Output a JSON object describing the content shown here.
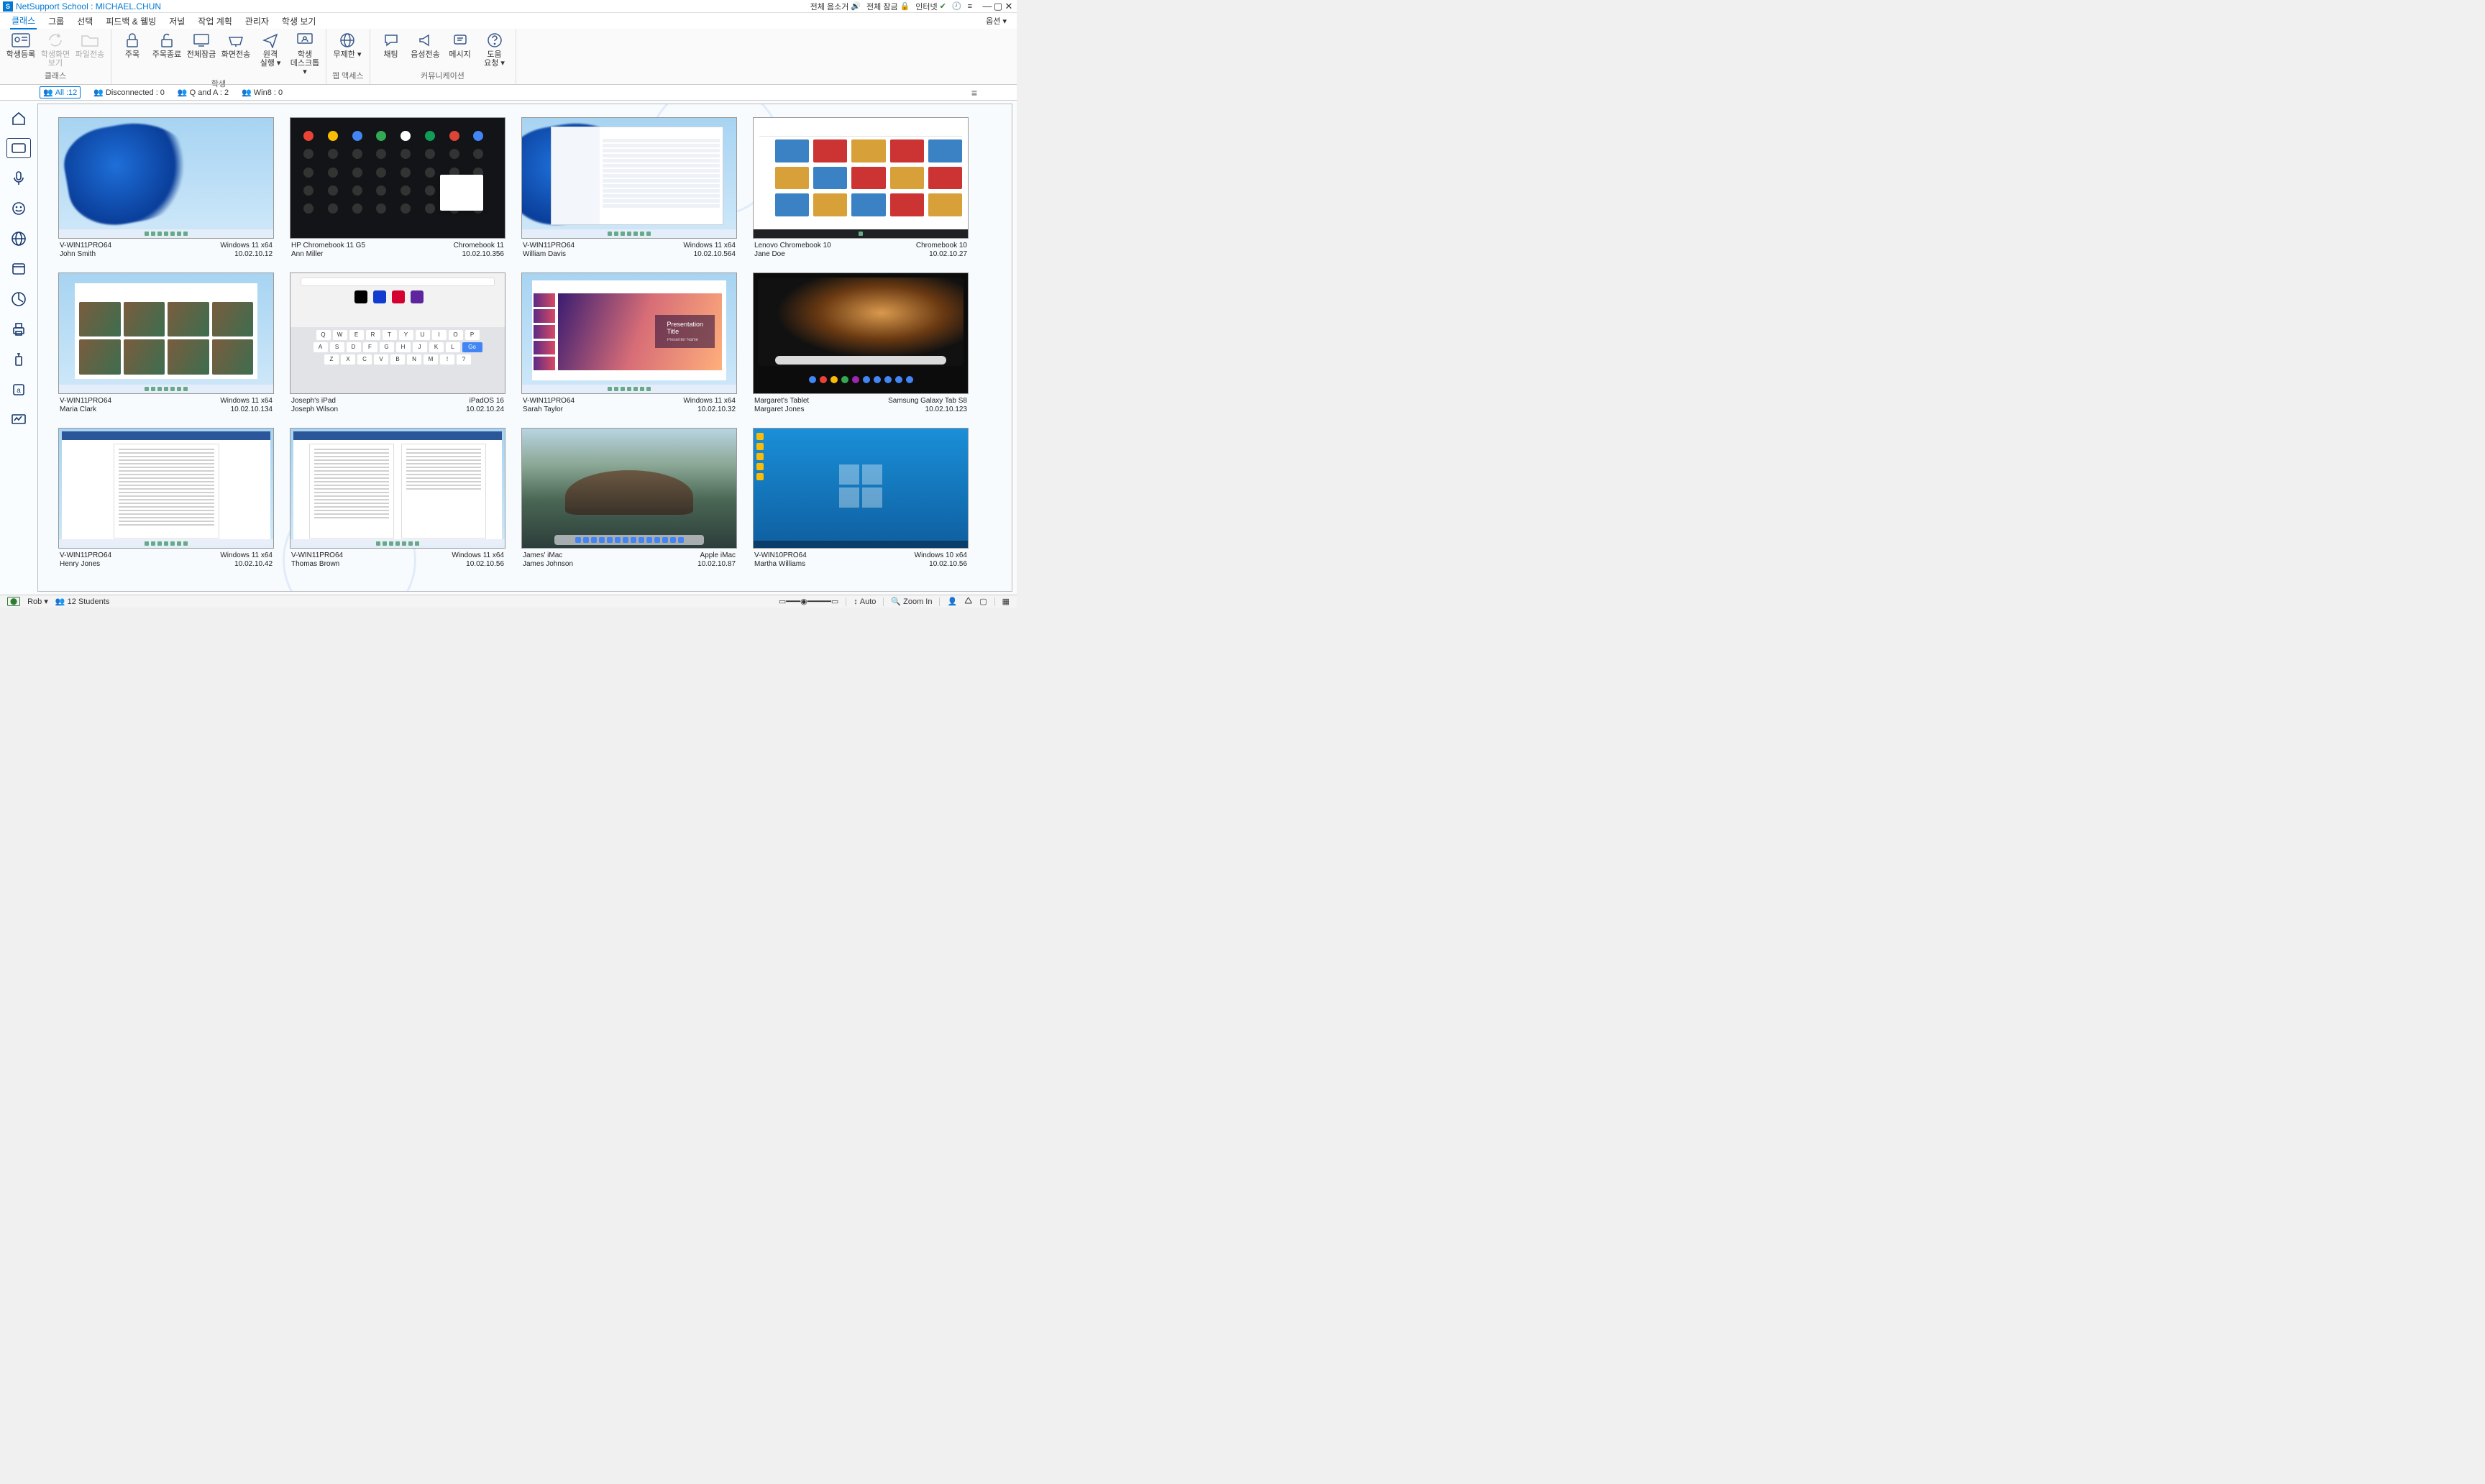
{
  "title": {
    "app": "NetSupport School",
    "sep": " : ",
    "machine": "MICHAEL.CHUN"
  },
  "titlebar_right": {
    "mute_all": "전체 음소거",
    "lock_all": "전체 잠금",
    "internet": "인터넷"
  },
  "menu": {
    "class": "클래스",
    "group": "그룹",
    "select": "선택",
    "feedback": "피드백 & 웰빙",
    "journal": "저널",
    "planner": "작업 계획",
    "admin": "관리자",
    "view": "학생 보기",
    "options": "옵션"
  },
  "ribbon": {
    "register": "학생등록",
    "screenshot": "학생화면\n보기",
    "file_transfer": "파일전송",
    "attention": "주목",
    "end_attention": "주목종료",
    "lock_all": "전체잠금",
    "show": "화면전송",
    "remote_run": "원격\n실행",
    "student_desktop": "학생\n데스크톱",
    "unlimited": "무제한",
    "chat": "채팅",
    "audio": "음성전송",
    "message": "메시지",
    "help": "도움\n요청",
    "group_class": "클래스",
    "group_student": "학생",
    "group_web": "웹 액세스",
    "group_comm": "커뮤니케이션"
  },
  "tabs": {
    "all": "All :12",
    "disconnected": "Disconnected : 0",
    "qa": "Q and A : 2",
    "win8": "Win8 : 0"
  },
  "thumbs": [
    {
      "host": "V-WIN11PRO64",
      "os": "Windows 11 x64",
      "user": "John Smith",
      "ip": "10.02.10.12",
      "type": "win11"
    },
    {
      "host": "HP Chromebook 11 G5",
      "os": "Chromebook 11",
      "user": "Ann Miller",
      "ip": "10.02.10.356",
      "type": "chrome-dark"
    },
    {
      "host": "V-WIN11PRO64",
      "os": "Windows 11 x64",
      "user": "William Davis",
      "ip": "10.02.10.564",
      "type": "win11-explorer"
    },
    {
      "host": "Lenovo Chromebook 10",
      "os": "Chromebook 10",
      "user": "Jane Doe",
      "ip": "10.02.10.27",
      "type": "chromebk-web"
    },
    {
      "host": "V-WIN11PRO64",
      "os": "Windows 11 x64",
      "user": "Maria Clark",
      "ip": "10.02.10.134",
      "type": "edge-news"
    },
    {
      "host": "Joseph's iPad",
      "os": "iPadOS 16",
      "user": "Joseph Wilson",
      "ip": "10.02.10.24",
      "type": "ipad",
      "keys": [
        [
          "Q",
          "W",
          "E",
          "R",
          "T",
          "Y",
          "U",
          "I",
          "O",
          "P"
        ],
        [
          "A",
          "S",
          "D",
          "F",
          "G",
          "H",
          "J",
          "K",
          "L",
          "Go"
        ],
        [
          "Z",
          "X",
          "C",
          "V",
          "B",
          "N",
          "M",
          "!",
          "?"
        ]
      ]
    },
    {
      "host": "V-WIN11PRO64",
      "os": "Windows 11 x64",
      "user": "Sarah Taylor",
      "ip": "10.02.10.32",
      "type": "ppt",
      "title": "Presentation\nTitle",
      "sub": "Presenter Name"
    },
    {
      "host": "Margaret's Tablet",
      "os": "Samsung Galaxy Tab S8",
      "user": "Margaret Jones",
      "ip": "10.02.10.123",
      "type": "android"
    },
    {
      "host": "V-WIN11PRO64",
      "os": "Windows 11 x64",
      "user": "Henry Jones",
      "ip": "10.02.10.42",
      "type": "word"
    },
    {
      "host": "V-WIN11PRO64",
      "os": "Windows 11 x64",
      "user": "Thomas Brown",
      "ip": "10.02.10.56",
      "type": "word2"
    },
    {
      "host": "James' iMac",
      "os": "Apple iMac",
      "user": "James Johnson",
      "ip": "10.02.10.87",
      "type": "mac"
    },
    {
      "host": "V-WIN10PRO64",
      "os": "Windows 10 x64",
      "user": "Martha Williams",
      "ip": "10.02.10.56",
      "type": "win10"
    }
  ],
  "status": {
    "user": "Rob",
    "students": "12 Students",
    "auto": "Auto",
    "zoom": "Zoom In"
  }
}
